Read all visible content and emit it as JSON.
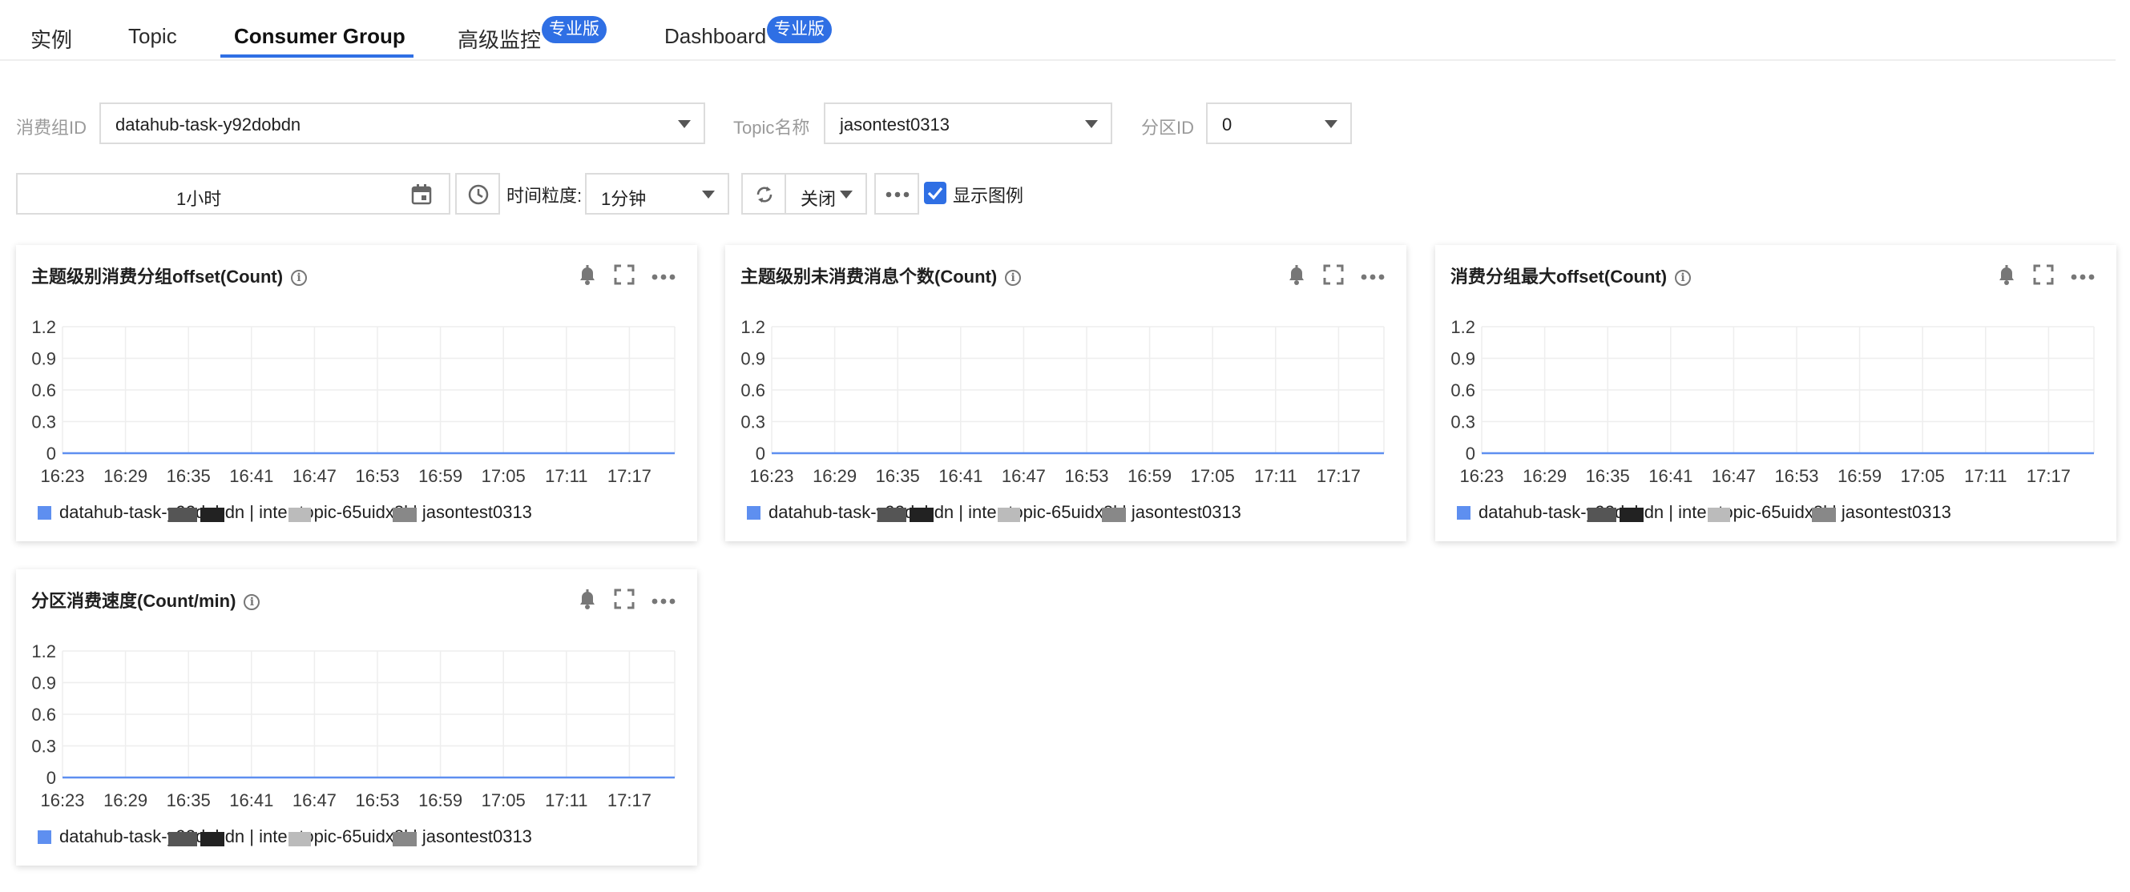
{
  "tabs": [
    {
      "label": "实例"
    },
    {
      "label": "Topic"
    },
    {
      "label": "Consumer Group",
      "active": true
    },
    {
      "label": "高级监控",
      "badge": "专业版"
    },
    {
      "label": "Dashboard",
      "badge": "专业版"
    }
  ],
  "filters": {
    "group_label": "消费组ID",
    "group_value": "datahub-task-y92dobdn",
    "topic_label": "Topic名称",
    "topic_value": "jasontest0313",
    "partition_label": "分区ID",
    "partition_value": "0"
  },
  "toolbar": {
    "time_range": "1小时",
    "granularity_label": "时间粒度:",
    "granularity_value": "1分钟",
    "refresh_value": "关闭",
    "legend_toggle_label": "显示图例",
    "legend_toggle_checked": true
  },
  "colors": {
    "accent": "#2f6fe4",
    "series": "#5e8ff0",
    "grid": "#eeeeee"
  },
  "panels": [
    {
      "title": "主题级别消费分组offset(Count)",
      "legend": "datahub-task-y92dobdn | inter-topic-65uidx8l | jasontest0313"
    },
    {
      "title": "主题级别未消费消息个数(Count)",
      "legend": "datahub-task-y92dobdn | inter-topic-65uidx8l | jasontest0313"
    },
    {
      "title": "消费分组最大offset(Count)",
      "legend": "datahub-task-y92dobdn | inter-topic-65uidx8l | jasontest0313"
    },
    {
      "title": "分区消费速度(Count/min)",
      "legend": "datahub-task-y92dobdn | inter-topic-65uidx8l | jasontest0313"
    }
  ],
  "chart_data": [
    {
      "type": "line",
      "title": "主题级别消费分组offset(Count)",
      "x": [
        "16:23",
        "16:29",
        "16:35",
        "16:41",
        "16:47",
        "16:53",
        "16:59",
        "17:05",
        "17:11",
        "17:17"
      ],
      "yticks": [
        0,
        0.3,
        0.6,
        0.9,
        1.2
      ],
      "ylim": [
        0,
        1.2
      ],
      "grid": true,
      "legend": "bottom",
      "series": [
        {
          "values": [
            0,
            0,
            0,
            0,
            0,
            0,
            0,
            0,
            0,
            0
          ]
        }
      ]
    },
    {
      "type": "line",
      "title": "主题级别未消费消息个数(Count)",
      "x": [
        "16:23",
        "16:29",
        "16:35",
        "16:41",
        "16:47",
        "16:53",
        "16:59",
        "17:05",
        "17:11",
        "17:17"
      ],
      "yticks": [
        0,
        0.3,
        0.6,
        0.9,
        1.2
      ],
      "ylim": [
        0,
        1.2
      ],
      "grid": true,
      "legend": "bottom",
      "series": [
        {
          "values": [
            0,
            0,
            0,
            0,
            0,
            0,
            0,
            0,
            0,
            0
          ]
        }
      ]
    },
    {
      "type": "line",
      "title": "消费分组最大offset(Count)",
      "x": [
        "16:23",
        "16:29",
        "16:35",
        "16:41",
        "16:47",
        "16:53",
        "16:59",
        "17:05",
        "17:11",
        "17:17"
      ],
      "yticks": [
        0,
        0.3,
        0.6,
        0.9,
        1.2
      ],
      "ylim": [
        0,
        1.2
      ],
      "grid": true,
      "legend": "bottom",
      "series": [
        {
          "values": [
            0,
            0,
            0,
            0,
            0,
            0,
            0,
            0,
            0,
            0
          ]
        }
      ]
    },
    {
      "type": "line",
      "title": "分区消费速度(Count/min)",
      "x": [
        "16:23",
        "16:29",
        "16:35",
        "16:41",
        "16:47",
        "16:53",
        "16:59",
        "17:05",
        "17:11",
        "17:17"
      ],
      "yticks": [
        0,
        0.3,
        0.6,
        0.9,
        1.2
      ],
      "ylim": [
        0,
        1.2
      ],
      "grid": true,
      "legend": "bottom",
      "series": [
        {
          "values": [
            0,
            0,
            0,
            0,
            0,
            0,
            0,
            0,
            0,
            0
          ]
        }
      ]
    }
  ]
}
